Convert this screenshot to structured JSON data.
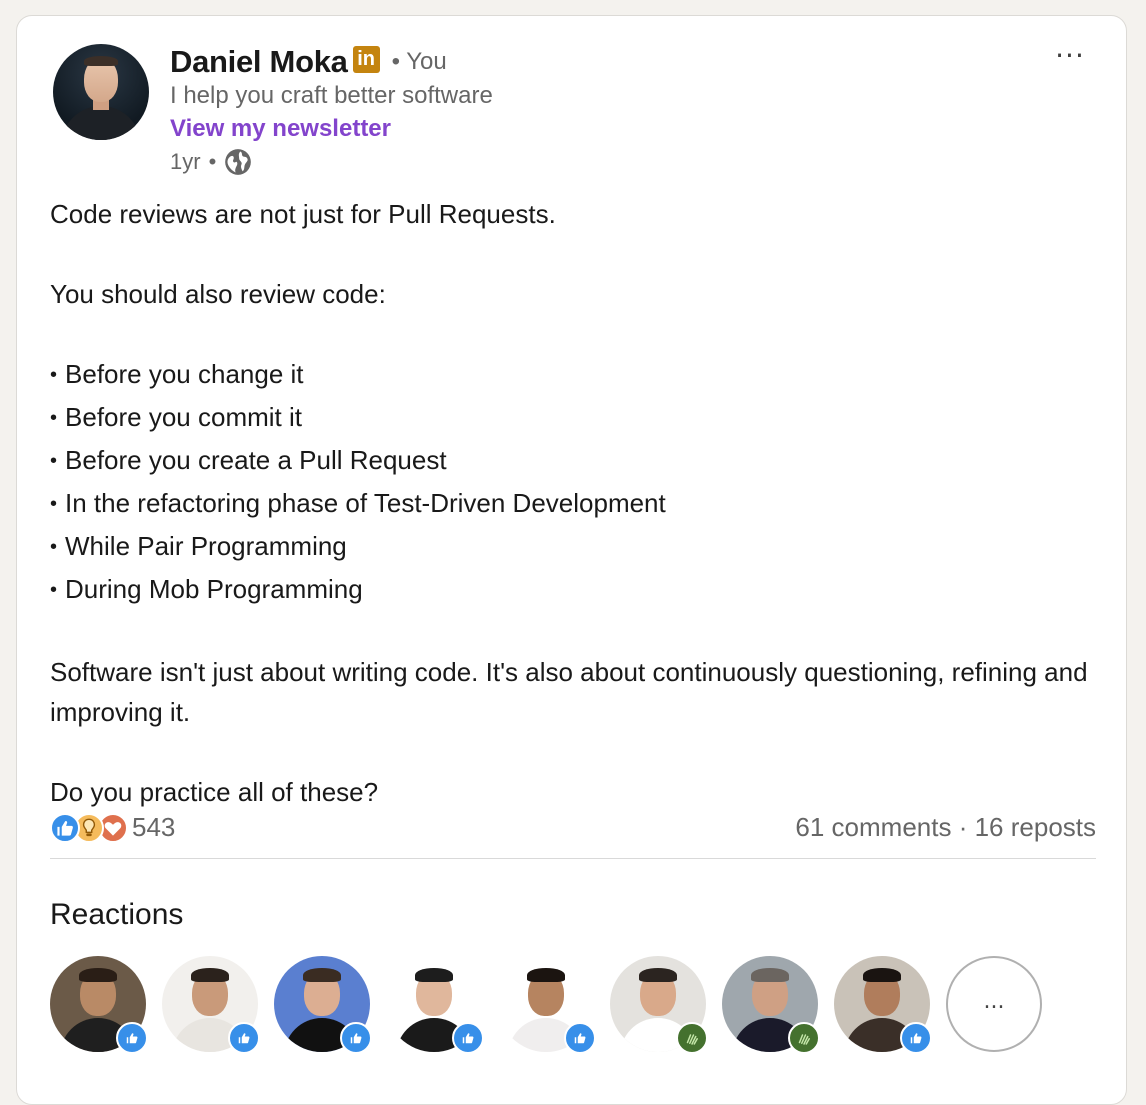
{
  "post": {
    "author": {
      "name": "Daniel Moka",
      "badge_text": "in",
      "relation": "• You",
      "headline": "I help you craft better software",
      "newsletter_link": "View my newsletter",
      "time": "1yr",
      "time_separator": "•"
    },
    "more_menu_label": "···",
    "body": {
      "intro": "Code reviews are not just for Pull Requests.",
      "lead": "You should also review code:",
      "items": [
        "Before you change it",
        "Before you commit it",
        "Before you create a Pull Request",
        "In the refactoring phase of Test-Driven Development",
        "While Pair Programming",
        "During Mob Programming"
      ],
      "conclusion": "Software isn't just about writing code. It's also about continuously questioning, refining and improving it.",
      "question": "Do you practice all of these?"
    },
    "social": {
      "reaction_count": "543",
      "comments": "61 comments",
      "separator": " · ",
      "reposts": "16 reposts",
      "reaction_types": [
        "like-icon",
        "insightful-icon",
        "love-icon"
      ]
    },
    "reactions_section": {
      "title": "Reactions",
      "reactors": [
        {
          "reaction": "like",
          "bg": "#6b5a48",
          "skin": "#b98a66",
          "hair": "#2a1e16",
          "shirt": "#1f1f1f"
        },
        {
          "reaction": "like",
          "bg": "#f2f0ed",
          "skin": "#c99a7a",
          "hair": "#2b221c",
          "shirt": "#e8e5e0"
        },
        {
          "reaction": "like",
          "bg": "#5a7fd0",
          "skin": "#dcae92",
          "hair": "#3a2c22",
          "shirt": "#111111"
        },
        {
          "reaction": "like",
          "bg": "#ffffff",
          "skin": "#e0b79c",
          "hair": "#1d1d1d",
          "shirt": "#1a1a1a"
        },
        {
          "reaction": "like",
          "bg": "#ffffff",
          "skin": "#b68460",
          "hair": "#1b1410",
          "shirt": "#f0eeee"
        },
        {
          "reaction": "celebrate",
          "bg": "#e4e2de",
          "skin": "#d9a98a",
          "hair": "#2b2420",
          "shirt": "#ffffff"
        },
        {
          "reaction": "celebrate",
          "bg": "#9fa7ad",
          "skin": "#cfa084",
          "hair": "#6b6560",
          "shirt": "#1a1a2a"
        },
        {
          "reaction": "like",
          "bg": "#c9c2b8",
          "skin": "#b07d5c",
          "hair": "#1a1411",
          "shirt": "#3a2f28"
        }
      ],
      "more_label": "..."
    },
    "colors": {
      "newsletter": "#8344cc",
      "linkedin_badge": "#c4840f",
      "like": "#378fe9",
      "celebrate": "#44712e"
    }
  }
}
